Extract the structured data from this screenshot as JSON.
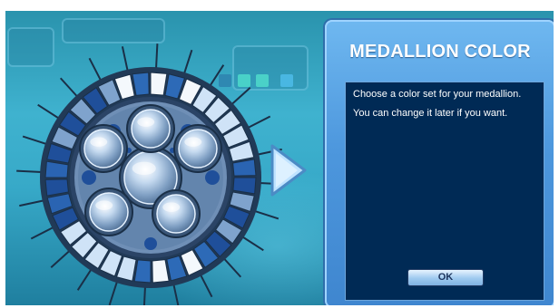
{
  "dialog": {
    "title": "MEDALLION COLOR",
    "line1": "Choose a color set for your medallion.",
    "line2": "You can change it later if you want.",
    "ok_label": "OK"
  },
  "icons": {
    "next_arrow": "chevron-right-icon"
  },
  "colors": {
    "dialog_blue": "#4d97dd",
    "dialog_body": "#002a55",
    "medallion_dark": "#1f4f9a",
    "medallion_light": "#cfe3f7"
  }
}
